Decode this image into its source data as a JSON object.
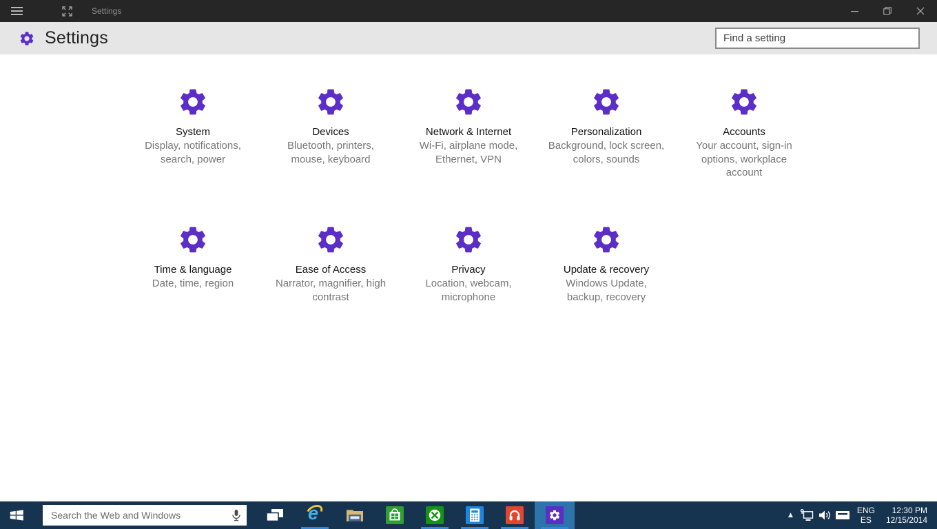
{
  "window": {
    "title": "Settings"
  },
  "header": {
    "title": "Settings",
    "search_placeholder": "Find a setting"
  },
  "categories": [
    {
      "title": "System",
      "description": "Display, notifications, search, power"
    },
    {
      "title": "Devices",
      "description": "Bluetooth, printers, mouse, keyboard"
    },
    {
      "title": "Network & Internet",
      "description": "Wi-Fi, airplane mode, Ethernet, VPN"
    },
    {
      "title": "Personalization",
      "description": "Background, lock screen, colors, sounds"
    },
    {
      "title": "Accounts",
      "description": "Your account, sign-in options, workplace account"
    },
    {
      "title": "Time & language",
      "description": "Date, time, region"
    },
    {
      "title": "Ease of Access",
      "description": "Narrator, magnifier, high contrast"
    },
    {
      "title": "Privacy",
      "description": "Location, webcam, microphone"
    },
    {
      "title": "Update & recovery",
      "description": "Windows Update, backup, recovery"
    }
  ],
  "taskbar": {
    "search_placeholder": "Search the Web and Windows",
    "apps": [
      {
        "name": "task-view",
        "running": false
      },
      {
        "name": "internet-explorer",
        "running": true
      },
      {
        "name": "file-explorer",
        "running": false
      },
      {
        "name": "store",
        "running": false
      },
      {
        "name": "xbox",
        "running": true
      },
      {
        "name": "calculator",
        "running": true
      },
      {
        "name": "contact-support",
        "running": true
      },
      {
        "name": "settings",
        "running": true,
        "active": true
      }
    ],
    "tray": {
      "hidden_icons_chevron": "▲",
      "language_primary": "ENG",
      "language_secondary": "ES",
      "time": "12:30 PM",
      "date": "12/15/2014"
    }
  },
  "colors": {
    "accent_purple": "#5b2ec8",
    "titlebar": "#262626",
    "header_bg": "#e6e6e6",
    "taskbar": "#16344f",
    "active_app_highlight": "#2e74aa",
    "running_underline": "#3387d6",
    "description_text": "#767676"
  }
}
